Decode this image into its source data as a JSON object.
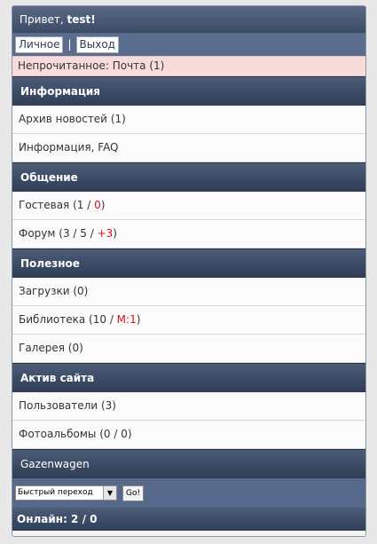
{
  "header": {
    "greeting": "Привет, ",
    "username": "test!"
  },
  "userbar": {
    "personal": "Личное",
    "separator": "|",
    "logout": "Выход"
  },
  "unread": "Непрочитанное: Почта (1)",
  "sections": [
    {
      "title": "Информация"
    },
    {
      "title": "Общение"
    },
    {
      "title": "Полезное"
    },
    {
      "title": "Актив сайта"
    },
    {
      "title": "Gazenwagen"
    }
  ],
  "items": {
    "news": {
      "label": "Архив новостей",
      "count": "(1)"
    },
    "faq": {
      "label": "Информация, FAQ"
    },
    "guestbook": {
      "label": "Гостевая",
      "open": "(1 / ",
      "new": "0",
      "close": ")"
    },
    "forum": {
      "label": "Форум",
      "open": "(3 / 5 / ",
      "new": "+3",
      "close": ")"
    },
    "downloads": {
      "label": "Загрузки",
      "count": "(0)"
    },
    "library": {
      "label": "Библиотека",
      "open": "(10 / ",
      "mod": "M:1",
      "close": ")"
    },
    "gallery": {
      "label": "Галерея",
      "count": "(0)"
    },
    "users": {
      "label": "Пользователи",
      "count": "(3)"
    },
    "photoalbums": {
      "label": "Фотоальбомы",
      "count": "(0 / 0)"
    }
  },
  "quickjump": {
    "selected": "Быстрый переход",
    "go": "Go!"
  },
  "online": "Онлайн: 2 / 0",
  "colors": {
    "header": "#3d4c66",
    "bar": "#5a6d8e",
    "accent_red": "#dd1111",
    "unread_bg": "#f8dcdc"
  }
}
